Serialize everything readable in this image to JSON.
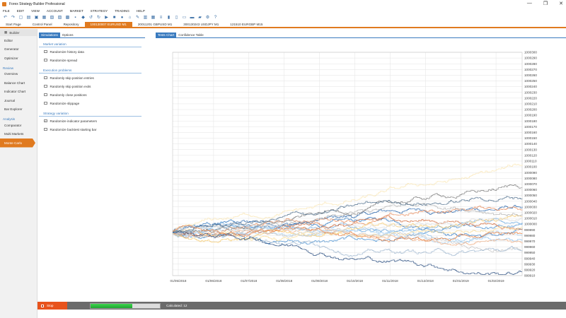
{
  "window": {
    "title": "Forex Strategy Builder Professional",
    "controls": [
      "—",
      "❐",
      "✕"
    ]
  },
  "menu": [
    "FILE",
    "EDIT",
    "VIEW",
    "ACCOUNT",
    "MARKET",
    "STRATEGY",
    "TRADING",
    "HELP"
  ],
  "toolbar_icons": [
    "undo-icon",
    "redo-icon",
    "new-icon",
    "open-icon",
    "save-icon",
    "save-as-icon",
    "paste-icon",
    "copy-icon",
    "save-all-icon",
    "folder-icon",
    "pointer-icon",
    "undo2-icon",
    "redo2-icon",
    "play-icon",
    "stop-icon",
    "record-icon",
    "home-icon",
    "pin-icon",
    "chart-icon",
    "grid-icon",
    "list-icon",
    "bars-icon",
    "layout-icon",
    "table-icon",
    "window-icon",
    "chart2-icon",
    "settings-icon",
    "help-icon"
  ],
  "toolbar_glyphs": [
    "↶",
    "↷",
    "▢",
    "▤",
    "▣",
    "▦",
    "▧",
    "▨",
    "▩",
    "▪",
    "◆",
    "↺",
    "↻",
    "▶",
    "■",
    "●",
    "⌂",
    "✎",
    "▥",
    "▦",
    "≡",
    "▮",
    "▯",
    "▭",
    "▬",
    "▰",
    "⚙",
    "?"
  ],
  "tabs": [
    {
      "label": "Start Page",
      "active": false
    },
    {
      "label": "Control Panel",
      "active": false
    },
    {
      "label": "Repository",
      "active": false
    },
    {
      "label": "100130007 EURUSD M1",
      "active": true
    },
    {
      "label": "20011201 GBPUSD M1",
      "active": false
    },
    {
      "label": "300130243 USDJPY M1",
      "active": false
    },
    {
      "label": "121510 EURGBP M15",
      "active": false
    }
  ],
  "sidebar": {
    "top": "Builder",
    "items": [
      {
        "type": "item",
        "label": "Editor"
      },
      {
        "type": "item",
        "label": "Generator"
      },
      {
        "type": "item",
        "label": "Optimizer"
      },
      {
        "type": "group",
        "label": "Review"
      },
      {
        "type": "item",
        "label": "Overview"
      },
      {
        "type": "item",
        "label": "Balance Chart"
      },
      {
        "type": "item",
        "label": "Indicator Chart"
      },
      {
        "type": "item",
        "label": "Journal"
      },
      {
        "type": "item",
        "label": "Bar Explorer"
      },
      {
        "type": "group",
        "label": "Analysis"
      },
      {
        "type": "item",
        "label": "Comparator"
      },
      {
        "type": "item",
        "label": "Multi Markets"
      },
      {
        "type": "item",
        "label": "Monte Carlo",
        "active": true
      }
    ]
  },
  "left_panel": {
    "tabs": [
      "Simulations",
      "Options"
    ],
    "sections": [
      {
        "title": "Market variation",
        "options": [
          {
            "label": "Randomize history data",
            "checked": false
          },
          {
            "label": "Randomize spread",
            "checked": false
          }
        ]
      },
      {
        "title": "Execution problems",
        "options": [
          {
            "label": "Randomly skip position entries",
            "checked": false
          },
          {
            "label": "Randomly skip position exits",
            "checked": false
          },
          {
            "label": "Randomly close positions",
            "checked": false
          },
          {
            "label": "Randomize slippage",
            "checked": false
          }
        ]
      },
      {
        "title": "Strategy variation",
        "options": [
          {
            "label": "Randomize indicator parameters",
            "checked": true
          },
          {
            "label": "Randomize backtest starting bar",
            "checked": false
          }
        ]
      }
    ]
  },
  "chart_tabs": [
    "Tests Chart",
    "Confidence Table"
  ],
  "chart_data": {
    "type": "line",
    "x_labels": [
      "01/05/2018",
      "01/06/2018",
      "01/07/2018",
      "01/08/2018",
      "01/09/2018",
      "01/10/2018",
      "01/11/2018",
      "01/12/2018",
      "01/01/2019",
      "01/02/2019"
    ],
    "ylim": [
      999910,
      1000300
    ],
    "y_step": 10,
    "grid": true,
    "series_count": 20,
    "colors": [
      "#1f5fa8",
      "#2f77c0",
      "#4a90d0",
      "#6aa8df",
      "#8cc0ea",
      "#a9d2f2",
      "#d2693a",
      "#e58a5a",
      "#f0ad82",
      "#f5c96a",
      "#f8dc95",
      "#fbe7b4",
      "#b0b0b0",
      "#c8c8c8",
      "#dadada",
      "#7a7a7a",
      "#4b6b8a",
      "#9fb7cf",
      "#e57c3c",
      "#2a4e80"
    ]
  },
  "status": {
    "stop_label": "Stop",
    "progress": 0.6,
    "text": "Calculated: 12"
  }
}
